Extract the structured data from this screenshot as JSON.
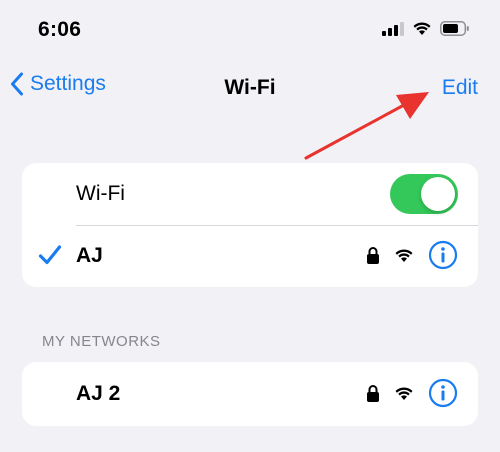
{
  "status_bar": {
    "time": "6:06",
    "icons": [
      "cellular-signal-icon",
      "wifi-icon",
      "battery-icon"
    ]
  },
  "nav": {
    "back_label": "Settings",
    "title": "Wi-Fi",
    "edit_label": "Edit"
  },
  "wifi_toggle": {
    "label": "Wi-Fi",
    "on": true
  },
  "current_network": {
    "name": "AJ",
    "connected": true,
    "icons": [
      "lock-icon",
      "wifi-icon",
      "info-icon"
    ]
  },
  "my_networks": {
    "header": "MY NETWORKS",
    "items": [
      {
        "name": "AJ 2",
        "icons": [
          "lock-icon",
          "wifi-icon",
          "info-icon"
        ]
      }
    ]
  },
  "colors": {
    "accent": "#1a7cf0",
    "toggle_on": "#34c759",
    "background": "#f1f1f6",
    "annotation_arrow": "#e8332e"
  }
}
